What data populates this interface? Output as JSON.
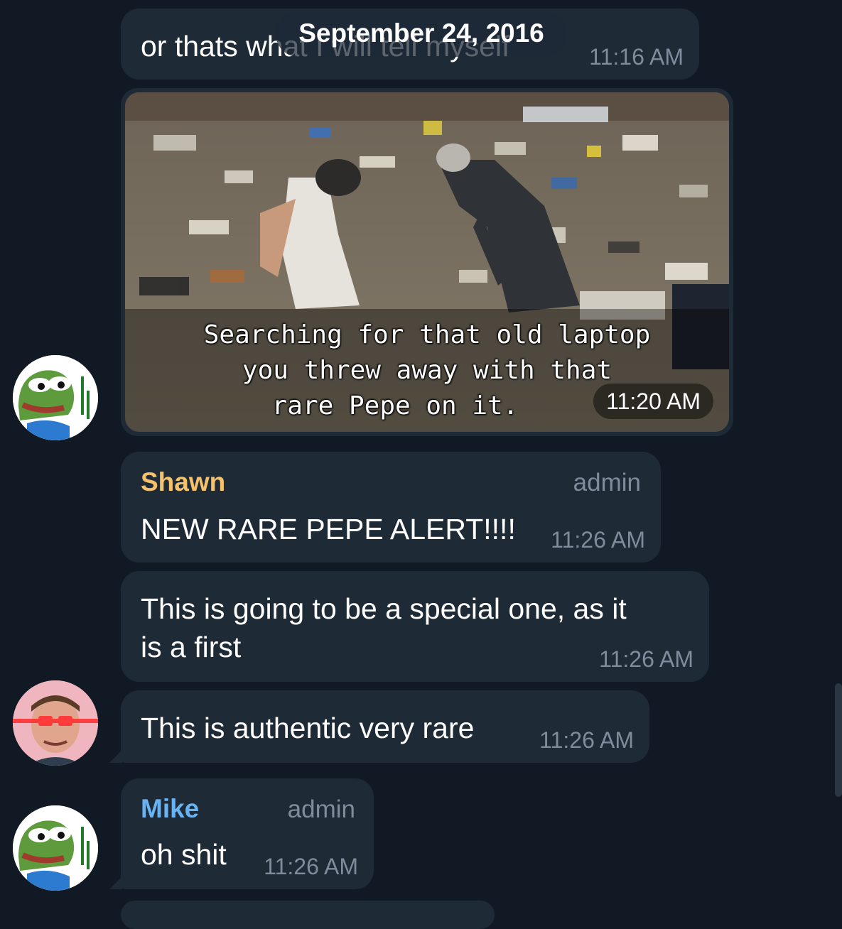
{
  "date_header": "September 24, 2016",
  "colors": {
    "background": "#111a24",
    "bubble": "#1f2a37",
    "shawn_name": "#f5c26b",
    "mike_name": "#6ab3f3",
    "meta_text": "#7e8c9c"
  },
  "messages": {
    "m1": {
      "text": "or thats what I will tell myself",
      "time": "11:16 AM"
    },
    "photo": {
      "caption_line1": "Searching for that old laptop",
      "caption_line2": "you threw away with that",
      "caption_line3": "rare Pepe on it.",
      "time": "11:20 AM",
      "avatar_icon": "pepe-avatar-icon"
    },
    "m3": {
      "sender": "Shawn",
      "role": "admin",
      "text": "NEW RARE PEPE ALERT!!!!",
      "time": "11:26 AM"
    },
    "m4": {
      "text": "This is going to be a special one, as it\nis a first",
      "time": "11:26 AM"
    },
    "m5": {
      "text": "This is authentic very rare",
      "time": "11:26 AM",
      "avatar_icon": "laser-eyes-avatar-icon"
    },
    "m6": {
      "sender": "Mike",
      "role": "admin",
      "text": "oh shit",
      "time": "11:26 AM",
      "avatar_icon": "pepe-avatar-icon"
    }
  }
}
